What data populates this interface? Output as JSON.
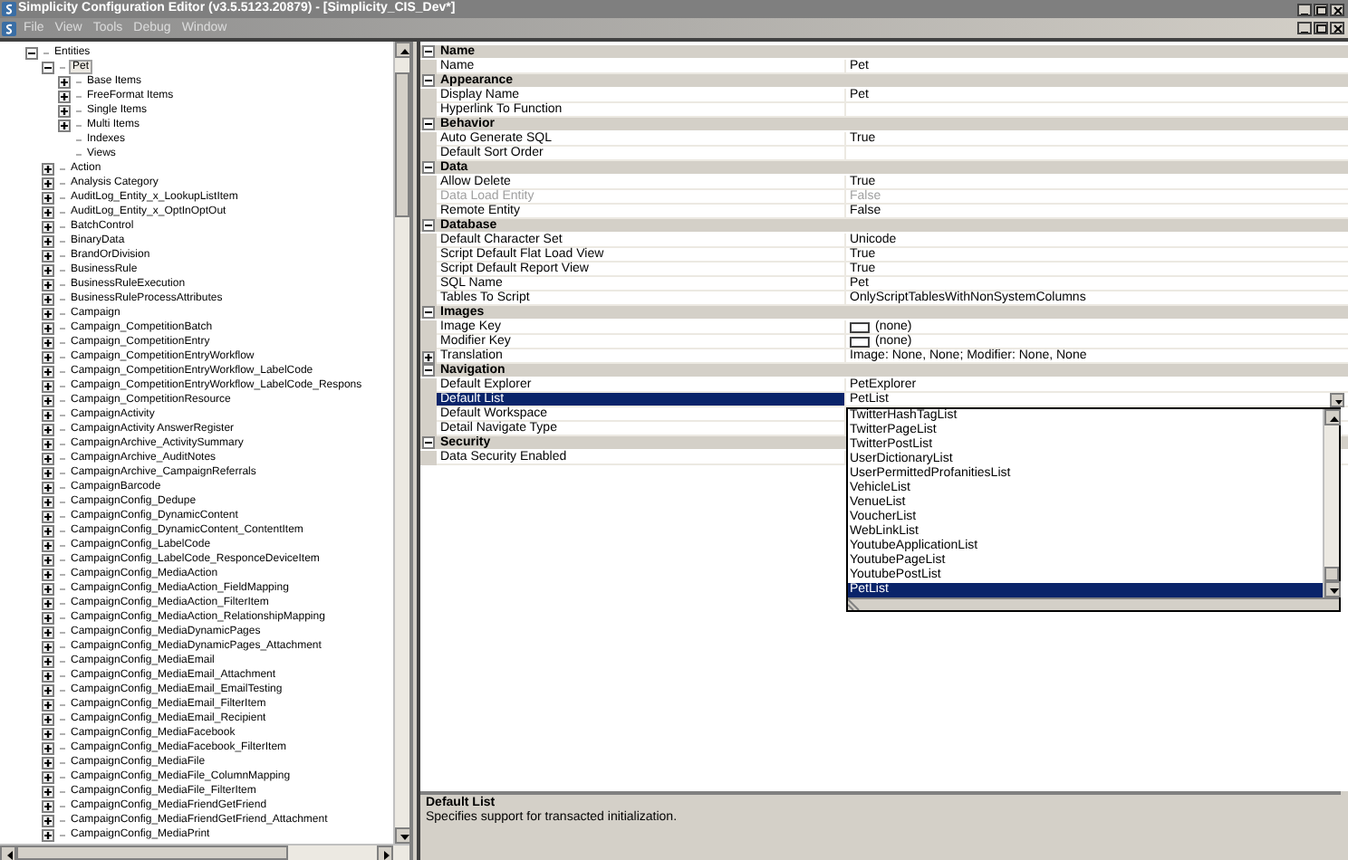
{
  "window": {
    "title": "Simplicity Configuration Editor (v3.5.5123.20879) - [Simplicity_CIS_Dev*]"
  },
  "menu": [
    "File",
    "View",
    "Tools",
    "Debug",
    "Window"
  ],
  "tree": [
    {
      "label": "Entities",
      "expanded": true,
      "selected": false,
      "children": [
        {
          "label": "Pet",
          "expanded": true,
          "selected": true,
          "children": [
            {
              "label": "Base Items",
              "kind": "branch",
              "expanded": false,
              "selected": false
            },
            {
              "label": "FreeFormat Items",
              "kind": "branch",
              "expanded": false,
              "selected": false
            },
            {
              "label": "Single Items",
              "kind": "branch",
              "expanded": false,
              "selected": false
            },
            {
              "label": "Multi Items",
              "kind": "branch",
              "expanded": false,
              "selected": false
            },
            {
              "label": "Indexes",
              "kind": "leaf",
              "selected": false
            },
            {
              "label": "Views",
              "kind": "leaf",
              "selected": false
            }
          ]
        },
        {
          "label": "Action",
          "expanded": false,
          "selected": false
        },
        {
          "label": "Analysis Category",
          "expanded": false,
          "selected": false
        },
        {
          "label": "AuditLog_Entity_x_LookupListItem",
          "expanded": false,
          "selected": false
        },
        {
          "label": "AuditLog_Entity_x_OptInOptOut",
          "expanded": false,
          "selected": false
        },
        {
          "label": "BatchControl",
          "expanded": false,
          "selected": false
        },
        {
          "label": "BinaryData",
          "expanded": false,
          "selected": false
        },
        {
          "label": "BrandOrDivision",
          "expanded": false,
          "selected": false
        },
        {
          "label": "BusinessRule",
          "expanded": false,
          "selected": false
        },
        {
          "label": "BusinessRuleExecution",
          "expanded": false,
          "selected": false
        },
        {
          "label": "BusinessRuleProcessAttributes",
          "expanded": false,
          "selected": false
        },
        {
          "label": "Campaign",
          "expanded": false,
          "selected": false
        },
        {
          "label": "Campaign_CompetitionBatch",
          "expanded": false,
          "selected": false
        },
        {
          "label": "Campaign_CompetitionEntry",
          "expanded": false,
          "selected": false
        },
        {
          "label": "Campaign_CompetitionEntryWorkflow",
          "expanded": false,
          "selected": false
        },
        {
          "label": "Campaign_CompetitionEntryWorkflow_LabelCode",
          "expanded": false,
          "selected": false
        },
        {
          "label": "Campaign_CompetitionEntryWorkflow_LabelCode_Respons",
          "expanded": false,
          "selected": false
        },
        {
          "label": "Campaign_CompetitionResource",
          "expanded": false,
          "selected": false
        },
        {
          "label": "CampaignActivity",
          "expanded": false,
          "selected": false
        },
        {
          "label": "CampaignActivity AnswerRegister",
          "expanded": false,
          "selected": false
        },
        {
          "label": "CampaignArchive_ActivitySummary",
          "expanded": false,
          "selected": false
        },
        {
          "label": "CampaignArchive_AuditNotes",
          "expanded": false,
          "selected": false
        },
        {
          "label": "CampaignArchive_CampaignReferrals",
          "expanded": false,
          "selected": false
        },
        {
          "label": "CampaignBarcode",
          "expanded": false,
          "selected": false
        },
        {
          "label": "CampaignConfig_Dedupe",
          "expanded": false,
          "selected": false
        },
        {
          "label": "CampaignConfig_DynamicContent",
          "expanded": false,
          "selected": false
        },
        {
          "label": "CampaignConfig_DynamicContent_ContentItem",
          "expanded": false,
          "selected": false
        },
        {
          "label": "CampaignConfig_LabelCode",
          "expanded": false,
          "selected": false
        },
        {
          "label": "CampaignConfig_LabelCode_ResponceDeviceItem",
          "expanded": false,
          "selected": false
        },
        {
          "label": "CampaignConfig_MediaAction",
          "expanded": false,
          "selected": false
        },
        {
          "label": "CampaignConfig_MediaAction_FieldMapping",
          "expanded": false,
          "selected": false
        },
        {
          "label": "CampaignConfig_MediaAction_FilterItem",
          "expanded": false,
          "selected": false
        },
        {
          "label": "CampaignConfig_MediaAction_RelationshipMapping",
          "expanded": false,
          "selected": false
        },
        {
          "label": "CampaignConfig_MediaDynamicPages",
          "expanded": false,
          "selected": false
        },
        {
          "label": "CampaignConfig_MediaDynamicPages_Attachment",
          "expanded": false,
          "selected": false
        },
        {
          "label": "CampaignConfig_MediaEmail",
          "expanded": false,
          "selected": false
        },
        {
          "label": "CampaignConfig_MediaEmail_Attachment",
          "expanded": false,
          "selected": false
        },
        {
          "label": "CampaignConfig_MediaEmail_EmailTesting",
          "expanded": false,
          "selected": false
        },
        {
          "label": "CampaignConfig_MediaEmail_FilterItem",
          "expanded": false,
          "selected": false
        },
        {
          "label": "CampaignConfig_MediaEmail_Recipient",
          "expanded": false,
          "selected": false
        },
        {
          "label": "CampaignConfig_MediaFacebook",
          "expanded": false,
          "selected": false
        },
        {
          "label": "CampaignConfig_MediaFacebook_FilterItem",
          "expanded": false,
          "selected": false
        },
        {
          "label": "CampaignConfig_MediaFile",
          "expanded": false,
          "selected": false
        },
        {
          "label": "CampaignConfig_MediaFile_ColumnMapping",
          "expanded": false,
          "selected": false
        },
        {
          "label": "CampaignConfig_MediaFile_FilterItem",
          "expanded": false,
          "selected": false
        },
        {
          "label": "CampaignConfig_MediaFriendGetFriend",
          "expanded": false,
          "selected": false
        },
        {
          "label": "CampaignConfig_MediaFriendGetFriend_Attachment",
          "expanded": false,
          "selected": false
        },
        {
          "label": "CampaignConfig_MediaPrint",
          "expanded": false,
          "selected": false
        }
      ]
    }
  ],
  "properties": [
    {
      "category": "Name",
      "expanded": true,
      "rows": [
        {
          "name": "Name",
          "value": "Pet",
          "kind": "text",
          "selected": false,
          "disabled": false
        }
      ]
    },
    {
      "category": "Appearance",
      "expanded": true,
      "rows": [
        {
          "name": "Display Name",
          "value": "Pet",
          "kind": "text",
          "selected": false,
          "disabled": false
        },
        {
          "name": "Hyperlink To Function",
          "kind": "text",
          "selected": false,
          "disabled": false
        }
      ]
    },
    {
      "category": "Behavior",
      "expanded": true,
      "rows": [
        {
          "name": "Auto Generate SQL",
          "value": "True",
          "kind": "text",
          "selected": false,
          "disabled": false
        },
        {
          "name": "Default Sort Order",
          "kind": "text",
          "selected": false,
          "disabled": false
        }
      ]
    },
    {
      "category": "Data",
      "expanded": true,
      "rows": [
        {
          "name": "Allow Delete",
          "value": "True",
          "kind": "text",
          "selected": false,
          "disabled": false
        },
        {
          "name": "Data Load Entity",
          "value": "False",
          "kind": "text",
          "selected": false,
          "disabled": true
        },
        {
          "name": "Remote Entity",
          "value": "False",
          "kind": "text",
          "selected": false,
          "disabled": false
        }
      ]
    },
    {
      "category": "Database",
      "expanded": true,
      "rows": [
        {
          "name": "Default Character Set",
          "value": "Unicode",
          "kind": "text",
          "selected": false,
          "disabled": false
        },
        {
          "name": "Script Default Flat Load View",
          "value": "True",
          "kind": "text",
          "selected": false,
          "disabled": false
        },
        {
          "name": "Script Default Report View",
          "value": "True",
          "kind": "text",
          "selected": false,
          "disabled": false
        },
        {
          "name": "SQL Name",
          "value": "Pet",
          "kind": "text",
          "selected": false,
          "disabled": false
        },
        {
          "name": "Tables To Script",
          "value": "OnlyScriptTablesWithNonSystemColumns",
          "kind": "text",
          "selected": false,
          "disabled": false
        }
      ]
    },
    {
      "category": "Images",
      "expanded": true,
      "rows": [
        {
          "name": "Image Key",
          "value": "(none)",
          "kind": "image",
          "selected": false,
          "disabled": false
        },
        {
          "name": "Modifier Key",
          "value": "(none)",
          "kind": "image",
          "selected": false,
          "disabled": false
        },
        {
          "name": "Translation",
          "value": "Image: None, None; Modifier: None, None",
          "kind": "expandable",
          "selected": false,
          "disabled": false
        }
      ]
    },
    {
      "category": "Navigation",
      "expanded": true,
      "rows": [
        {
          "name": "Default Explorer",
          "value": "PetExplorer",
          "kind": "text",
          "selected": false,
          "disabled": false
        },
        {
          "name": "Default List",
          "value": "PetList",
          "kind": "dropdown",
          "selected": true,
          "disabled": false,
          "dropdown": [
            {
              "label": "TwitterHashTagList",
              "selected": false
            },
            {
              "label": "TwitterPageList",
              "selected": false
            },
            {
              "label": "TwitterPostList",
              "selected": false
            },
            {
              "label": "UserDictionaryList",
              "selected": false
            },
            {
              "label": "UserPermittedProfanitiesList",
              "selected": false
            },
            {
              "label": "VehicleList",
              "selected": false
            },
            {
              "label": "VenueList",
              "selected": false
            },
            {
              "label": "VoucherList",
              "selected": false
            },
            {
              "label": "WebLinkList",
              "selected": false
            },
            {
              "label": "YoutubeApplicationList",
              "selected": false
            },
            {
              "label": "YoutubePageList",
              "selected": false
            },
            {
              "label": "YoutubePostList",
              "selected": false
            },
            {
              "label": "PetList",
              "selected": true
            }
          ]
        },
        {
          "name": "Default Workspace",
          "kind": "text",
          "selected": false,
          "disabled": false
        },
        {
          "name": "Detail Navigate Type",
          "kind": "text",
          "selected": false,
          "disabled": false
        }
      ]
    },
    {
      "category": "Security",
      "expanded": true,
      "rows": [
        {
          "name": "Data Security Enabled",
          "kind": "text",
          "selected": false,
          "disabled": false
        }
      ]
    }
  ],
  "help": {
    "title": "Default List",
    "description": "Specifies support for transacted initialization."
  }
}
